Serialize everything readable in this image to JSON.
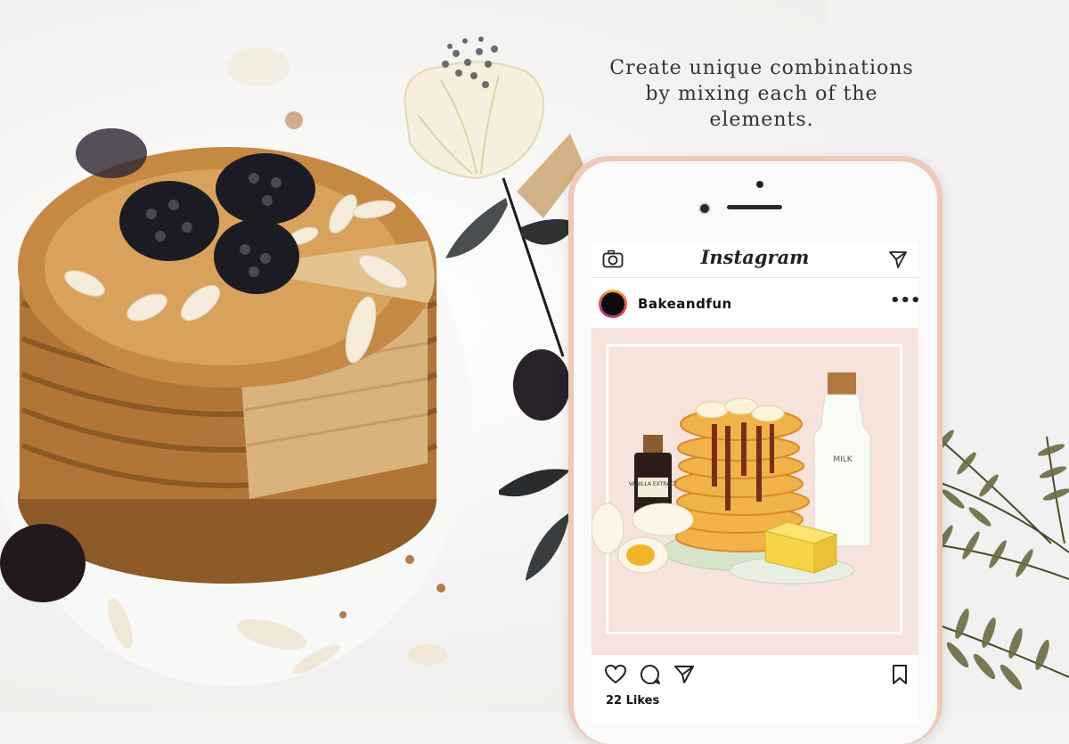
{
  "headline": {
    "line1": "Create unique combinations",
    "line2": "by mixing each of the",
    "line3": "elements."
  },
  "instagram": {
    "app_title": "Instagram",
    "username": "Bakeandfun",
    "more_label": "•••",
    "likes": "22 Likes",
    "icons": [
      "camera-icon",
      "send-icon",
      "heart-icon",
      "comment-icon",
      "share-icon",
      "bookmark-icon"
    ]
  },
  "post_image": {
    "milk_label": "MILK",
    "vanilla_label": "VANILLA EXTRACT"
  },
  "colors": {
    "phone_frame": "#efc8b8",
    "post_background": "#f5e3dc"
  }
}
